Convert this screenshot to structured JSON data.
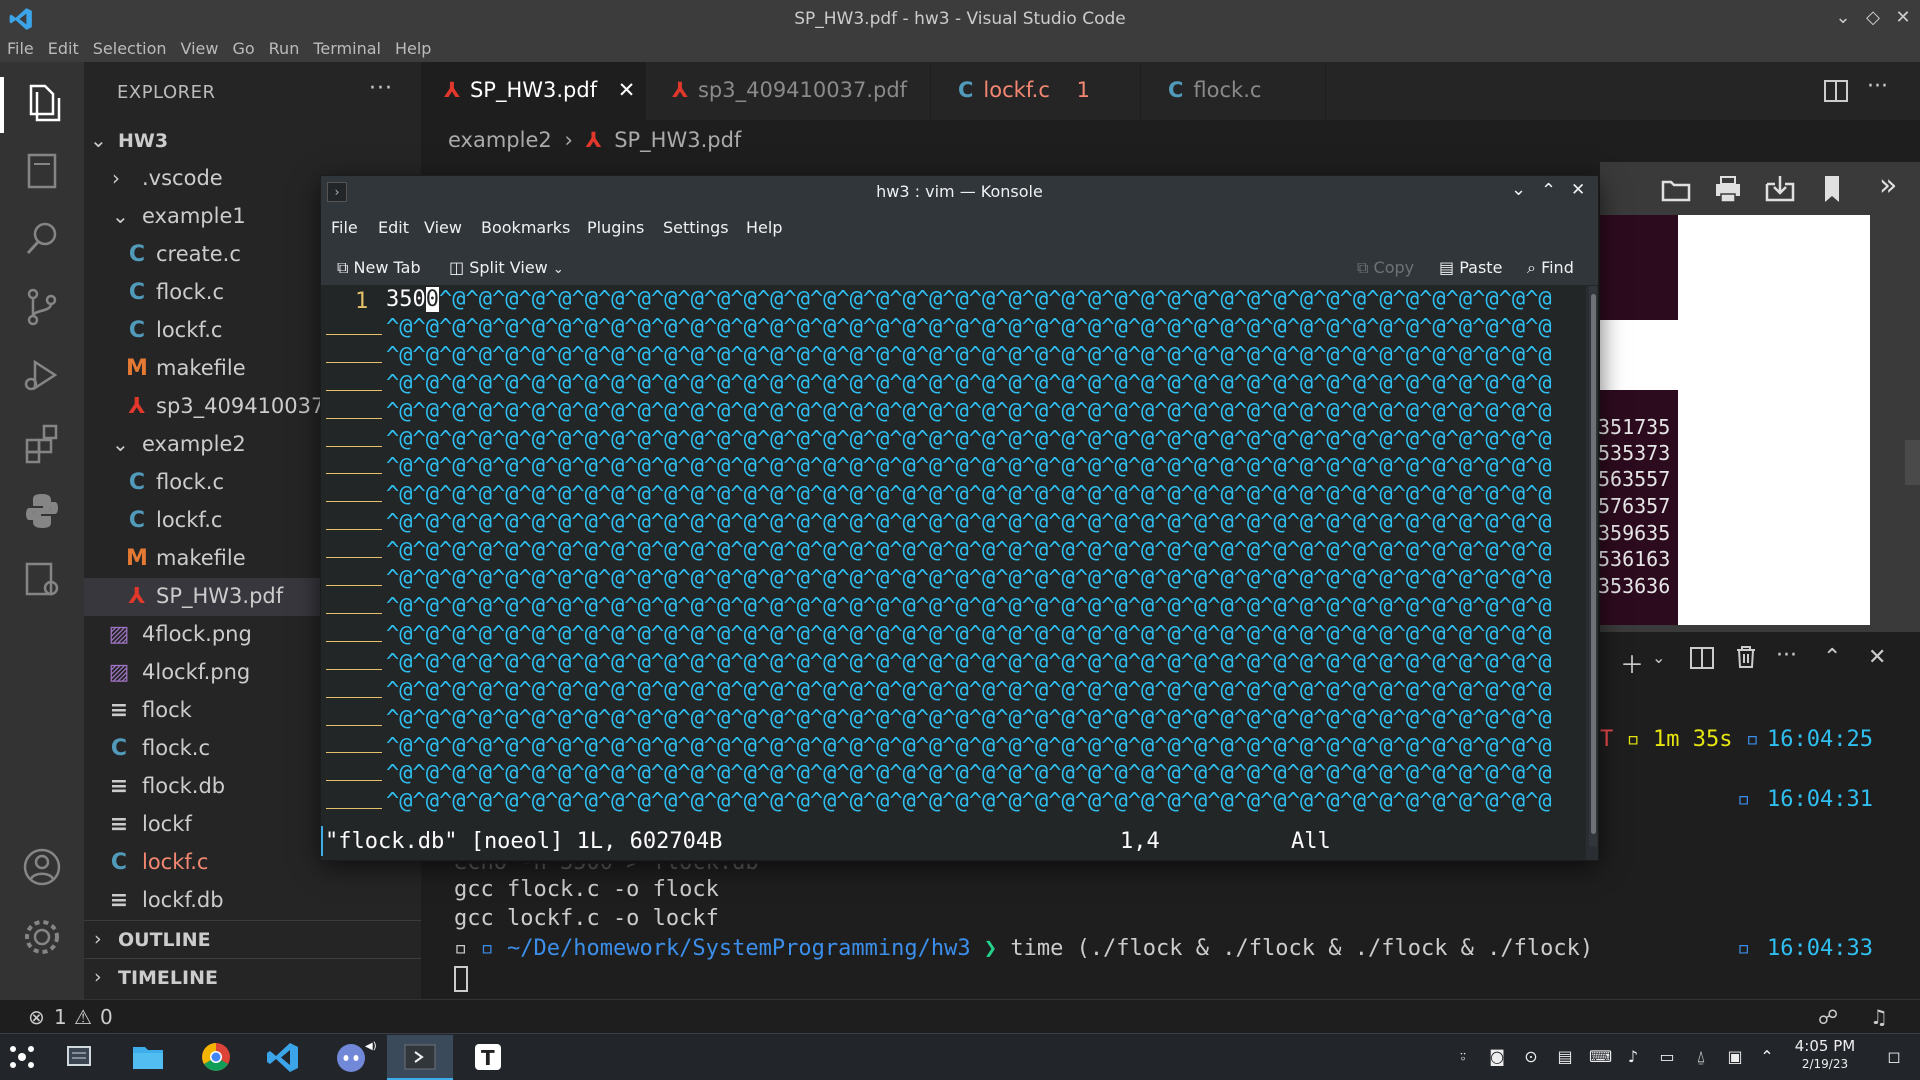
{
  "window": {
    "title": "SP_HW3.pdf - hw3 - Visual Studio Code"
  },
  "menu": [
    "File",
    "Edit",
    "Selection",
    "View",
    "Go",
    "Run",
    "Terminal",
    "Help"
  ],
  "explorer": {
    "header": "EXPLORER",
    "root": "HW3",
    "items": [
      {
        "label": ".vscode",
        "type": "folder"
      },
      {
        "label": "example1",
        "type": "folder-open"
      },
      {
        "label": "create.c",
        "type": "c"
      },
      {
        "label": "flock.c",
        "type": "c"
      },
      {
        "label": "lockf.c",
        "type": "c"
      },
      {
        "label": "makefile",
        "type": "make"
      },
      {
        "label": "sp3_409410037",
        "type": "pdf"
      },
      {
        "label": "example2",
        "type": "folder-open"
      },
      {
        "label": "flock.c",
        "type": "c"
      },
      {
        "label": "lockf.c",
        "type": "c"
      },
      {
        "label": "makefile",
        "type": "make"
      },
      {
        "label": "SP_HW3.pdf",
        "type": "pdf"
      },
      {
        "label": "4flock.png",
        "type": "png"
      },
      {
        "label": "4lockf.png",
        "type": "png"
      },
      {
        "label": "flock",
        "type": "txt"
      },
      {
        "label": "flock.c",
        "type": "c"
      },
      {
        "label": "flock.db",
        "type": "txt"
      },
      {
        "label": "lockf",
        "type": "txt"
      },
      {
        "label": "lockf.c",
        "type": "c-error"
      },
      {
        "label": "lockf.db",
        "type": "txt"
      }
    ],
    "outline": "OUTLINE",
    "timeline": "TIMELINE"
  },
  "tabs": [
    {
      "label": "SP_HW3.pdf",
      "icon": "pdf"
    },
    {
      "label": "sp3_409410037.pdf",
      "icon": "pdf"
    },
    {
      "label": "lockf.c",
      "icon": "c",
      "badge": "1"
    },
    {
      "label": "flock.c",
      "icon": "c"
    }
  ],
  "breadcrumb": {
    "folder": "example2",
    "file": "SP_HW3.pdf"
  },
  "pdf_numbers": [
    "351735",
    "535373",
    "563557",
    "576357",
    "359635",
    "536163",
    "353636"
  ],
  "terminal": {
    "line1_suffix": "T",
    "line1_duration": "1m 35s",
    "line1_time": "16:04:25",
    "line2_time": "16:04:31",
    "partial_line": "echo -n 3500 > flock.db",
    "lines": [
      "gcc flock.c -o flock",
      "gcc lockf.c -o lockf"
    ],
    "prompt_path": "~/De/homework/SystemProgramming/hw3",
    "prompt_arrow": "❯",
    "command": "time (./flock & ./flock & ./flock & ./flock)",
    "line5_time": "16:04:33"
  },
  "statusbar": {
    "errors": "1",
    "warnings": "0"
  },
  "konsole": {
    "title": "hw3 : vim — Konsole",
    "menu": [
      "File",
      "Edit",
      "View",
      "Bookmarks",
      "Plugins",
      "Settings",
      "Help"
    ],
    "toolbar": {
      "new_tab": "New Tab",
      "split_view": "Split View",
      "copy": "Copy",
      "paste": "Paste",
      "find": "Find"
    },
    "vim": {
      "line_number": "1",
      "content_prefix": "350",
      "cursor_char": "0",
      "status_left": "\"flock.db\" [noeol] 1L, 602704B",
      "status_pos": "1,4",
      "status_right": "All"
    }
  },
  "taskbar": {
    "time": "4:05 PM",
    "date": "2/19/23"
  }
}
